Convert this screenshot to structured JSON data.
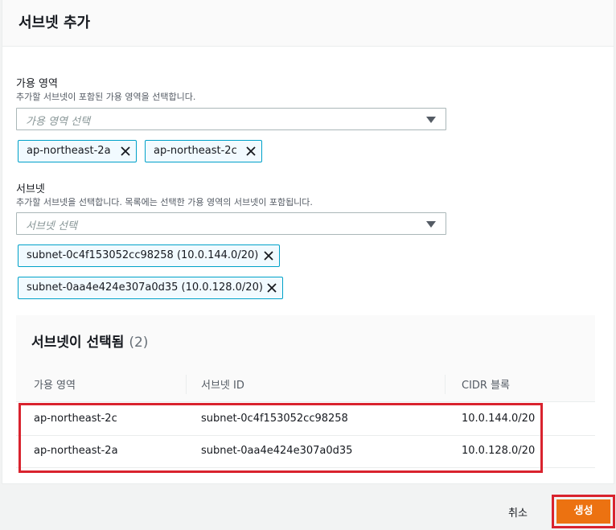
{
  "panel": {
    "title": "서브넷 추가"
  },
  "availability_zone": {
    "label": "가용 영역",
    "description": "추가할 서브넷이 포함된 가용 영역을 선택합니다.",
    "placeholder": "가용 영역 선택",
    "tokens": [
      "ap-northeast-2a",
      "ap-northeast-2c"
    ]
  },
  "subnet": {
    "label": "서브넷",
    "description": "추가할 서브넷을 선택합니다. 목록에는 선택한 가용 영역의 서브넷이 포함됩니다.",
    "placeholder": "서브넷 선택",
    "tokens": [
      "subnet-0c4f153052cc98258 (10.0.144.0/20)",
      "subnet-0aa4e424e307a0d35 (10.0.128.0/20)"
    ]
  },
  "selected": {
    "title": "서브넷이 선택됨",
    "count": "(2)",
    "columns": [
      "가용 영역",
      "서브넷 ID",
      "CIDR 블록"
    ],
    "rows": [
      {
        "az": "ap-northeast-2c",
        "subnet_id": "subnet-0c4f153052cc98258",
        "cidr": "10.0.144.0/20"
      },
      {
        "az": "ap-northeast-2a",
        "subnet_id": "subnet-0aa4e424e307a0d35",
        "cidr": "10.0.128.0/20"
      }
    ]
  },
  "footer": {
    "cancel_label": "취소",
    "create_label": "생성"
  },
  "colors": {
    "primary_button": "#ec7211",
    "token_border": "#00a1c9",
    "highlight": "#d9232e"
  }
}
